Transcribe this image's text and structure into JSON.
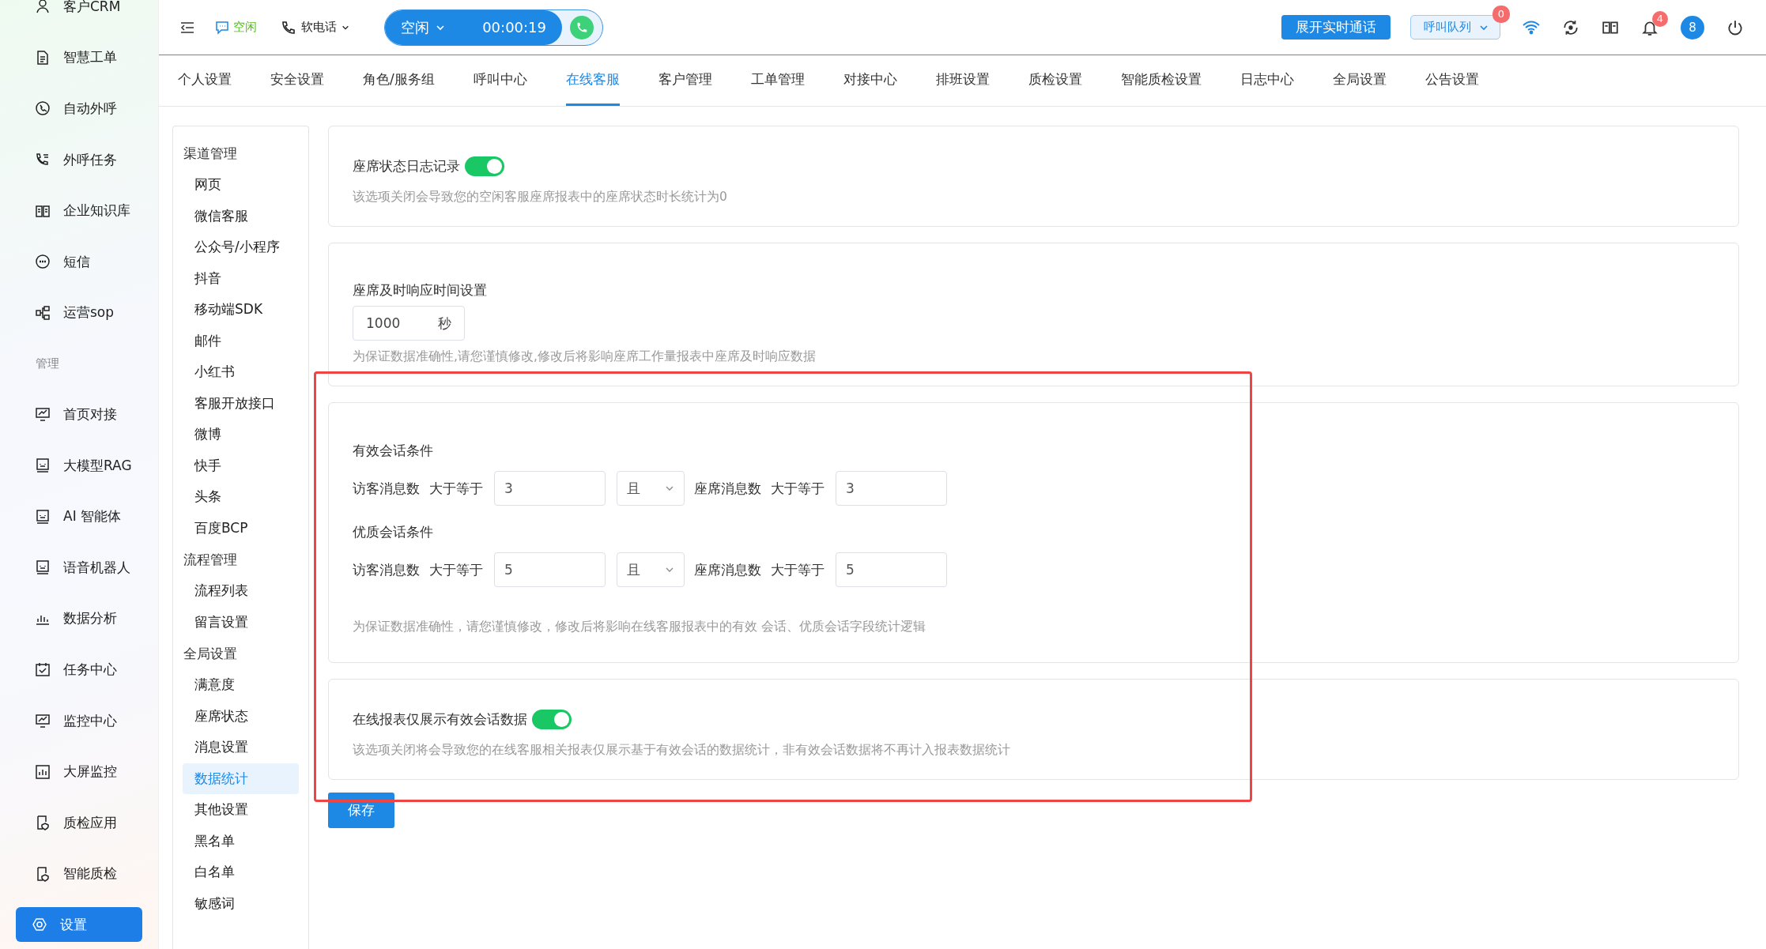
{
  "sidebar": {
    "items": [
      {
        "kind": "item",
        "label": "客户CRM",
        "selected": false
      },
      {
        "kind": "item",
        "label": "智慧工单",
        "selected": false
      },
      {
        "kind": "item",
        "label": "自动外呼",
        "selected": false
      },
      {
        "kind": "item",
        "label": "外呼任务",
        "selected": false
      },
      {
        "kind": "item",
        "label": "企业知识库",
        "selected": false
      },
      {
        "kind": "item",
        "label": "短信",
        "selected": false
      },
      {
        "kind": "item",
        "label": "运营sop",
        "selected": false
      },
      {
        "kind": "section",
        "label": "管理"
      },
      {
        "kind": "item",
        "label": "首页对接",
        "selected": false
      },
      {
        "kind": "item",
        "label": "大模型RAG",
        "selected": false
      },
      {
        "kind": "item",
        "label": "AI 智能体",
        "selected": false
      },
      {
        "kind": "item",
        "label": "语音机器人",
        "selected": false
      },
      {
        "kind": "item",
        "label": "数据分析",
        "selected": false
      },
      {
        "kind": "item",
        "label": "任务中心",
        "selected": false
      },
      {
        "kind": "item",
        "label": "监控中心",
        "selected": false
      },
      {
        "kind": "item",
        "label": "大屏监控",
        "selected": false
      },
      {
        "kind": "item",
        "label": "质检应用",
        "selected": false
      },
      {
        "kind": "item",
        "label": "智能质检",
        "selected": false
      },
      {
        "kind": "item",
        "label": "设置",
        "selected": true
      }
    ]
  },
  "topbar": {
    "chat_status": "空闲",
    "softphone": "软电话",
    "call": {
      "status": "空闲",
      "timer": "00:00:19"
    },
    "expand_button": "展开实时通话",
    "queue": {
      "label": "呼叫队列",
      "badge": "0"
    },
    "notifications_badge": "4",
    "avatar": "8"
  },
  "tabs": [
    {
      "label": "个人设置",
      "selected": false
    },
    {
      "label": "安全设置",
      "selected": false
    },
    {
      "label": "角色/服务组",
      "selected": false
    },
    {
      "label": "呼叫中心",
      "selected": false
    },
    {
      "label": "在线客服",
      "selected": true
    },
    {
      "label": "客户管理",
      "selected": false
    },
    {
      "label": "工单管理",
      "selected": false
    },
    {
      "label": "对接中心",
      "selected": false
    },
    {
      "label": "排班设置",
      "selected": false
    },
    {
      "label": "质检设置",
      "selected": false
    },
    {
      "label": "智能质检设置",
      "selected": false
    },
    {
      "label": "日志中心",
      "selected": false
    },
    {
      "label": "全局设置",
      "selected": false
    },
    {
      "label": "公告设置",
      "selected": false
    }
  ],
  "submenu": [
    {
      "title": "渠道管理",
      "items": [
        {
          "label": "网页",
          "selected": false
        },
        {
          "label": "微信客服",
          "selected": false
        },
        {
          "label": "公众号/小程序",
          "selected": false
        },
        {
          "label": "抖音",
          "selected": false
        },
        {
          "label": "移动端SDK",
          "selected": false
        },
        {
          "label": "邮件",
          "selected": false
        },
        {
          "label": "小红书",
          "selected": false
        },
        {
          "label": "客服开放接口",
          "selected": false
        },
        {
          "label": "微博",
          "selected": false
        },
        {
          "label": "快手",
          "selected": false
        },
        {
          "label": "头条",
          "selected": false
        },
        {
          "label": "百度BCP",
          "selected": false
        }
      ]
    },
    {
      "title": "流程管理",
      "items": [
        {
          "label": "流程列表",
          "selected": false
        },
        {
          "label": "留言设置",
          "selected": false
        }
      ]
    },
    {
      "title": "全局设置",
      "items": [
        {
          "label": "满意度",
          "selected": false
        },
        {
          "label": "座席状态",
          "selected": false
        },
        {
          "label": "消息设置",
          "selected": false
        },
        {
          "label": "数据统计",
          "selected": true
        },
        {
          "label": "其他设置",
          "selected": false
        },
        {
          "label": "黑名单",
          "selected": false
        },
        {
          "label": "白名单",
          "selected": false
        },
        {
          "label": "敏感词",
          "selected": false
        }
      ]
    }
  ],
  "cards": [
    {
      "kind": "toggle",
      "label": "座席状态日志记录",
      "on": true,
      "hint": "该选项关闭会导致您的空闲客服座席报表中的座席状态时长统计为0"
    },
    {
      "kind": "number",
      "label": "座席及时响应时间设置",
      "value": "1000",
      "unit": "秒",
      "hint": "为保证数据准确性,请您谨慎修改,修改后将影响座席工作量报表中座席及时响应数据"
    },
    {
      "kind": "conditions",
      "conditions": [
        {
          "title": "有效会话条件",
          "visitor_label": "访客消息数",
          "visitor_op": "大于等于",
          "visitor_value": "3",
          "logic": "且",
          "agent_label": "座席消息数",
          "agent_op": "大于等于",
          "agent_value": "3"
        },
        {
          "title": "优质会话条件",
          "visitor_label": "访客消息数",
          "visitor_op": "大于等于",
          "visitor_value": "5",
          "logic": "且",
          "agent_label": "座席消息数",
          "agent_op": "大于等于",
          "agent_value": "5"
        }
      ],
      "hint": "为保证数据准确性，请您谨慎修改，修改后将影响在线客服报表中的有效 会话、优质会话字段统计逻辑"
    },
    {
      "kind": "toggle",
      "label": "在线报表仅展示有效会话数据",
      "on": true,
      "hint": "该选项关闭将会导致您的在线客服相关报表仅展示基于有效会话的数据统计，非有效会话数据将不再计入报表数据统计"
    }
  ],
  "save_button": "保存"
}
